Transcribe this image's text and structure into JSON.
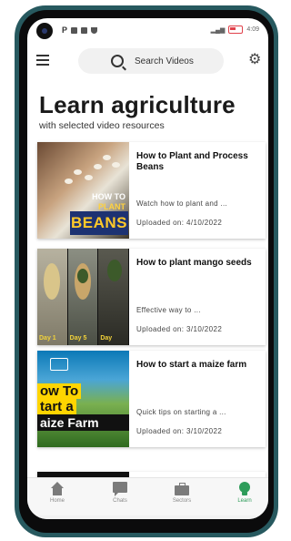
{
  "status_bar": {
    "time": "4:09"
  },
  "search": {
    "placeholder": "Search Videos"
  },
  "page": {
    "title": "Learn agriculture",
    "subtitle": "with selected video resources"
  },
  "videos": [
    {
      "title": "How to Plant and Process Beans",
      "description": "Watch how to plant and ...",
      "uploaded": "Uploaded on: 4/10/2022",
      "thumb_text": [
        "HOW TO",
        "PLANT",
        "BEANS"
      ]
    },
    {
      "title": "How to plant mango seeds",
      "description": "Effective way to ...",
      "uploaded": "Uploaded on: 3/10/2022",
      "thumb_text": [
        "Day 1",
        "Day 5",
        "Day"
      ]
    },
    {
      "title": "How to start a maize farm",
      "description": "Quick tips on starting a ...",
      "uploaded": "Uploaded on: 3/10/2022",
      "thumb_text": [
        "ow To",
        "tart a",
        "aize Farm"
      ]
    }
  ],
  "bottom_nav": [
    {
      "label": "Home",
      "icon": "home-icon",
      "active": false
    },
    {
      "label": "Chats",
      "icon": "chat-icon",
      "active": false
    },
    {
      "label": "Sectors",
      "icon": "briefcase-icon",
      "active": false
    },
    {
      "label": "Learn",
      "icon": "lightbulb-icon",
      "active": true
    }
  ],
  "colors": {
    "accent": "#2e9c5a",
    "phone_frame": "#27595f"
  }
}
